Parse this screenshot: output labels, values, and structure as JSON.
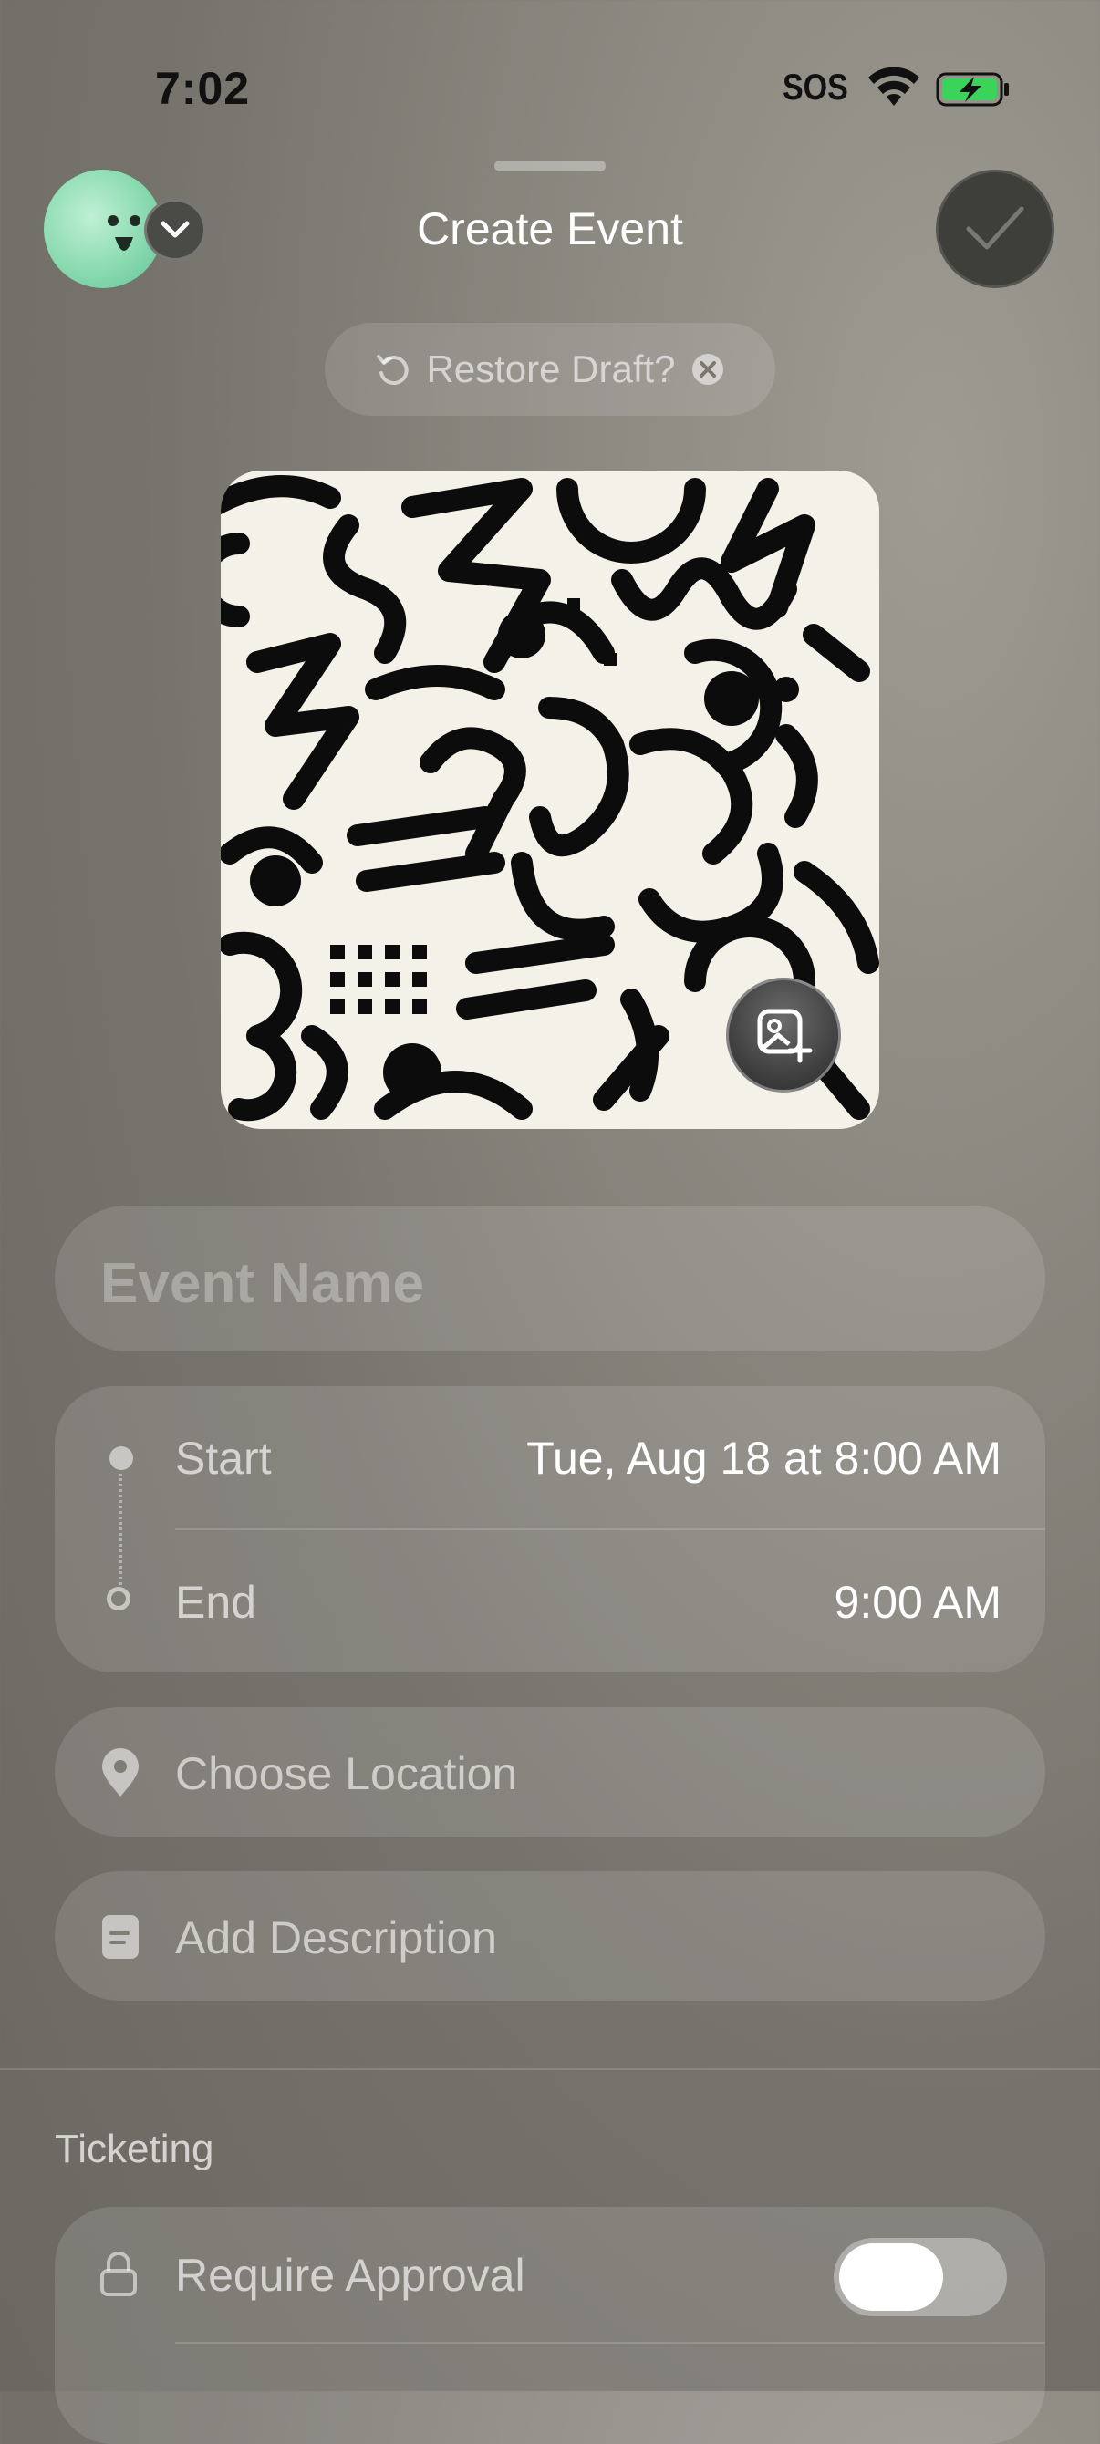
{
  "status_bar": {
    "time": "7:02",
    "carrier": "SOS"
  },
  "header": {
    "title": "Create Event"
  },
  "restore_draft": {
    "label": "Restore Draft?"
  },
  "event_name": {
    "placeholder": "Event Name"
  },
  "dates": {
    "start_label": "Start",
    "start_value": "Tue, Aug 18 at 8:00 AM",
    "end_label": "End",
    "end_value": "9:00 AM"
  },
  "location": {
    "label": "Choose Location"
  },
  "description": {
    "label": "Add Description"
  },
  "ticketing": {
    "section_title": "Ticketing",
    "require_approval_label": "Require Approval",
    "require_approval_on": false
  },
  "icons": {
    "avatar": "smiley-face-icon",
    "avatar_menu": "chevron-down-icon",
    "confirm": "checkmark-icon",
    "restore": "undo-icon",
    "dismiss": "close-circle-icon",
    "cover_edit": "add-photo-icon",
    "location": "map-pin-icon",
    "description": "document-icon",
    "approval": "lock-icon"
  }
}
